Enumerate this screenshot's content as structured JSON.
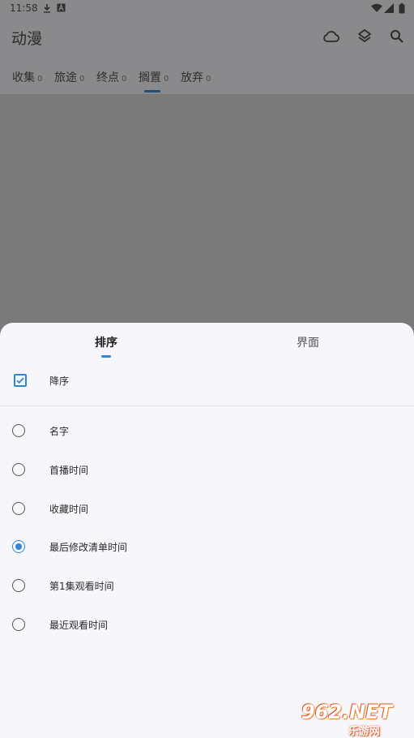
{
  "status_bar": {
    "time": "11:58",
    "icons": [
      "download-icon",
      "a-icon",
      "wifi-icon",
      "signal-icon",
      "battery-icon"
    ]
  },
  "app_bar": {
    "title": "动漫",
    "actions": [
      "cloud-icon",
      "layers-icon",
      "search-icon"
    ]
  },
  "tabs": [
    {
      "label": "收集",
      "count": "0"
    },
    {
      "label": "旅途",
      "count": "0"
    },
    {
      "label": "终点",
      "count": "0"
    },
    {
      "label": "搁置",
      "count": "0"
    },
    {
      "label": "放弃",
      "count": "0"
    }
  ],
  "active_tab_index": 3,
  "sheet": {
    "tabs": [
      "排序",
      "界面"
    ],
    "active_tab": "排序",
    "descending": {
      "label": "降序",
      "checked": true
    },
    "sort_options": [
      {
        "label": "名字",
        "selected": false
      },
      {
        "label": "首播时间",
        "selected": false
      },
      {
        "label": "收藏时间",
        "selected": false
      },
      {
        "label": "最后修改清单时间",
        "selected": true
      },
      {
        "label": "第1集观看时间",
        "selected": false
      },
      {
        "label": "最近观看时间",
        "selected": false
      }
    ]
  },
  "watermark": {
    "logo": "962.NET",
    "sub": "乐游网"
  },
  "colors": {
    "accent": "#2f86d6",
    "sheet_bg": "#f7f7fb",
    "scrim": "#7a7a7b"
  }
}
